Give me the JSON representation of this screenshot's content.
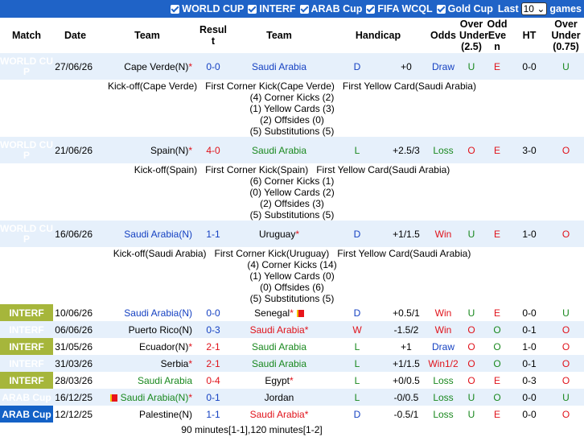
{
  "filters": {
    "items": [
      "WORLD CUP",
      "INTERF",
      "ARAB Cup",
      "FIFA WCQL",
      "Gold Cup"
    ],
    "last_label": "Last",
    "last_value": "10",
    "games_label": "games"
  },
  "headers": [
    "Match",
    "Date",
    "Team",
    "Result",
    "Team",
    "Handicap",
    "Odds",
    "Over Under (2.5)",
    "Odd Even",
    "HT",
    "Over Under (0.75)"
  ],
  "rows": [
    {
      "league": "WORLD CUP",
      "date": "27/06/26",
      "home": "Cape Verde(N)",
      "home_star": "*",
      "score": "0-0",
      "away": "Saudi Arabia",
      "away_star": "",
      "res": "D",
      "handicap": "+0",
      "odds": "Draw",
      "ou": "U",
      "oe": "E",
      "ht": "0-0",
      "ou2": "U"
    },
    {
      "league": "WORLD CUP",
      "date": "21/06/26",
      "home": "Spain(N)",
      "home_star": "*",
      "score": "4-0",
      "away": "Saudi Arabia",
      "away_star": "",
      "res": "L",
      "handicap": "+2.5/3",
      "odds": "Loss",
      "ou": "O",
      "oe": "E",
      "ht": "3-0",
      "ou2": "O"
    },
    {
      "league": "WORLD CUP",
      "date": "16/06/26",
      "home": "Saudi Arabia(N)",
      "home_star": "",
      "score": "1-1",
      "away": "Uruguay",
      "away_star": "*",
      "res": "D",
      "handicap": "+1/1.5",
      "odds": "Win",
      "ou": "U",
      "oe": "E",
      "ht": "1-0",
      "ou2": "O"
    },
    {
      "league": "INTERF",
      "date": "10/06/26",
      "home": "Saudi Arabia(N)",
      "home_star": "",
      "score": "0-0",
      "away": "Senegal",
      "away_star": "*",
      "res": "D",
      "handicap": "+0.5/1",
      "odds": "Win",
      "ou": "U",
      "oe": "E",
      "ht": "0-0",
      "ou2": "U"
    },
    {
      "league": "INTERF",
      "date": "06/06/26",
      "home": "Puerto Rico(N)",
      "home_star": "",
      "score": "0-3",
      "away": "Saudi Arabia",
      "away_star": "*",
      "res": "W",
      "handicap": "-1.5/2",
      "odds": "Win",
      "ou": "O",
      "oe": "O",
      "ht": "0-1",
      "ou2": "O"
    },
    {
      "league": "INTERF",
      "date": "31/05/26",
      "home": "Ecuador(N)",
      "home_star": "*",
      "score": "2-1",
      "away": "Saudi Arabia",
      "away_star": "",
      "res": "L",
      "handicap": "+1",
      "odds": "Draw",
      "ou": "O",
      "oe": "O",
      "ht": "1-0",
      "ou2": "O"
    },
    {
      "league": "INTERF",
      "date": "31/03/26",
      "home": "Serbia",
      "home_star": "*",
      "score": "2-1",
      "away": "Saudi Arabia",
      "away_star": "",
      "res": "L",
      "handicap": "+1/1.5",
      "odds": "Win1/2",
      "ou": "O",
      "oe": "O",
      "ht": "0-1",
      "ou2": "O"
    },
    {
      "league": "INTERF",
      "date": "28/03/26",
      "home": "Saudi Arabia",
      "home_star": "",
      "score": "0-4",
      "away": "Egypt",
      "away_star": "*",
      "res": "L",
      "handicap": "+0/0.5",
      "odds": "Loss",
      "ou": "O",
      "oe": "E",
      "ht": "0-3",
      "ou2": "O"
    },
    {
      "league": "ARAB Cup",
      "date": "16/12/25",
      "home": "Saudi Arabia(N)",
      "home_star": "*",
      "score": "0-1",
      "away": "Jordan",
      "away_star": "",
      "res": "L",
      "handicap": "-0/0.5",
      "odds": "Loss",
      "ou": "U",
      "oe": "O",
      "ht": "0-0",
      "ou2": "U"
    },
    {
      "league": "ARAB Cup",
      "date": "12/12/25",
      "home": "Palestine(N)",
      "home_star": "",
      "score": "1-1",
      "away": "Saudi Arabia",
      "away_star": "*",
      "res": "D",
      "handicap": "-0.5/1",
      "odds": "Loss",
      "ou": "U",
      "oe": "E",
      "ht": "0-0",
      "ou2": "O"
    }
  ],
  "details": [
    {
      "line1": "Kick-off(Cape Verde)   First Corner Kick(Cape Verde)   First Yellow Card(Saudi Arabia)",
      "line2": "(4) Corner Kicks (2)",
      "line3": "(1) Yellow Cards (3)",
      "line4": "(2) Offsides (0)",
      "line5": "(5) Substitutions (5)"
    },
    {
      "line1": "Kick-off(Spain)   First Corner Kick(Spain)   First Yellow Card(Saudi Arabia)",
      "line2": "(6) Corner Kicks (1)",
      "line3": "(0) Yellow Cards (2)",
      "line4": "(2) Offsides (3)",
      "line5": "(5) Substitutions (5)"
    },
    {
      "line1": "Kick-off(Saudi Arabia)   First Corner Kick(Uruguay)   First Yellow Card(Saudi Arabia)",
      "line2": "(4) Corner Kicks (14)",
      "line3": "(1) Yellow Cards (0)",
      "line4": "(0) Offsides (6)",
      "line5": "(5) Substitutions (5)"
    }
  ],
  "footer": "90 minutes[1-1],120 minutes[1-2]",
  "colors": {
    "world_cup": "#c0175d",
    "interf": "#a6b63b",
    "arab_cup": "#1361c6",
    "header_bar": "#1f63c7",
    "win": "#e0131b",
    "draw": "#1541c2",
    "loss": "#19881e"
  }
}
